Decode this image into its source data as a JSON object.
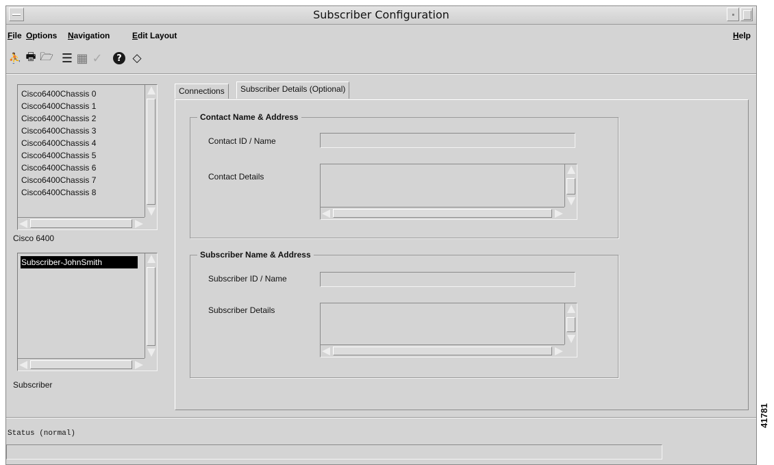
{
  "window": {
    "title": "Subscriber Configuration"
  },
  "menubar": {
    "file": {
      "underlined": "F",
      "rest": "ile"
    },
    "options": {
      "underlined": "O",
      "rest": "ptions"
    },
    "navigation": {
      "underlined": "N",
      "rest": "avigation"
    },
    "edit_layout": {
      "underlined": "E",
      "rest": "dit Layout"
    },
    "help": {
      "underlined": "H",
      "rest": "elp"
    }
  },
  "toolbar": {
    "icons": [
      "exit-icon",
      "print-icon",
      "open-folder-icon",
      "list-icon",
      "window-icon",
      "checkmark-icon",
      "help-icon",
      "refresh-icon"
    ],
    "exit_glyph": "⛹",
    "print_glyph": "🖶",
    "open_glyph": "🗁",
    "list_glyph": "☰",
    "window_glyph": "▦",
    "check_glyph": "✓",
    "help_glyph": "?",
    "refresh_glyph": "◇"
  },
  "left_panel": {
    "chassis_list": [
      "Cisco6400Chassis 0",
      "Cisco6400Chassis 1",
      "Cisco6400Chassis 2",
      "Cisco6400Chassis 3",
      "Cisco6400Chassis 4",
      "Cisco6400Chassis 5",
      "Cisco6400Chassis 6",
      "Cisco6400Chassis 7",
      "Cisco6400Chassis 8"
    ],
    "chassis_caption": "Cisco 6400",
    "subscriber_list": [
      "Subscriber-JohnSmith"
    ],
    "subscriber_selected": "Subscriber-JohnSmith",
    "subscriber_caption": "Subscriber"
  },
  "tabs": [
    {
      "label": "Connections",
      "active": false
    },
    {
      "label": "Subscriber Details (Optional)",
      "active": true
    }
  ],
  "contact_group": {
    "title": "Contact Name & Address",
    "id_label": "Contact ID / Name",
    "id_value": "",
    "details_label": "Contact Details",
    "details_value": ""
  },
  "subscriber_group": {
    "title": "Subscriber Name & Address",
    "id_label": "Subscriber ID / Name",
    "id_value": "",
    "details_label": "Subscriber Details",
    "details_value": ""
  },
  "status": {
    "label": "Status (normal)",
    "value": ""
  },
  "figure_id": "41781",
  "colors": {
    "window_bg": "#d4d4d4",
    "selection_bg": "#000000",
    "selection_fg": "#ffffff"
  }
}
